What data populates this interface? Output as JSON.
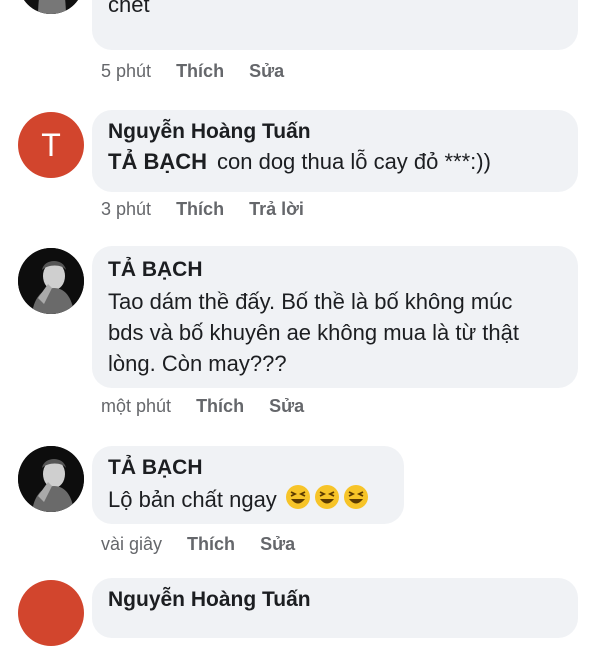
{
  "comments": [
    {
      "author": "",
      "text": "Mày thề đúc đi. Mày láo cả nhà mày, con mày chết",
      "time": "5 phút",
      "actions": [
        "Thích",
        "Sửa"
      ]
    },
    {
      "avatar_letter": "T",
      "author": "Nguyễn Hoàng Tuấn",
      "mention": "TẢ BẠCH",
      "text": "con dog thua lỗ cay đỏ ***:))",
      "time": "3 phút",
      "actions": [
        "Thích",
        "Trả lời"
      ]
    },
    {
      "author": "TẢ BẠCH",
      "text": "Tao dám thề đấy. Bố thề là bố không múc bds và bố khuyên ae không mua là từ thật lòng. Còn may???",
      "time": "một phút",
      "actions": [
        "Thích",
        "Sửa"
      ]
    },
    {
      "author": "TẢ BẠCH",
      "text": "Lộ bản chất ngay",
      "emoji": "laughing-face-icon",
      "time": "vài giây",
      "actions": [
        "Thích",
        "Sửa"
      ]
    },
    {
      "avatar_letter": "",
      "author": "Nguyễn Hoàng Tuấn"
    }
  ],
  "colors": {
    "bubble": "#f0f2f5",
    "avatar_letter_bg": "#d2452d",
    "meta_text": "#65676b"
  }
}
